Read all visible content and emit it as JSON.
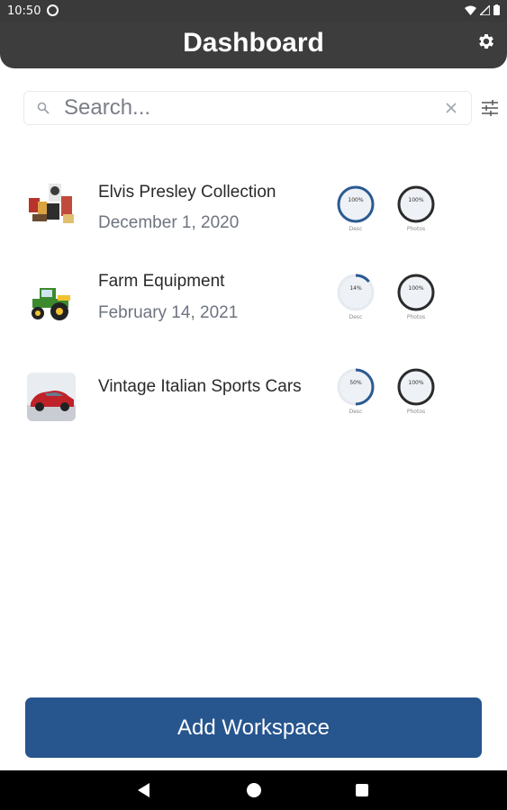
{
  "status_bar": {
    "time": "10:50"
  },
  "header": {
    "title": "Dashboard"
  },
  "search": {
    "placeholder": "Search..."
  },
  "workspaces": [
    {
      "title": "Elvis Presley Collection",
      "date": "December 1, 2020",
      "thumbnail": "memorabilia-collage",
      "desc": {
        "percent_text": "100%",
        "label": "Desc",
        "progress": 1.0
      },
      "photos": {
        "percent_text": "100%",
        "label": "Photos",
        "progress": 1.0
      }
    },
    {
      "title": "Farm Equipment",
      "date": "February 14, 2021",
      "thumbnail": "green-tractor",
      "desc": {
        "percent_text": "14%",
        "label": "Desc",
        "progress": 0.14
      },
      "photos": {
        "percent_text": "100%",
        "label": "Photos",
        "progress": 1.0
      }
    },
    {
      "title": "Vintage Italian Sports Cars",
      "date": "",
      "thumbnail": "red-sports-car",
      "desc": {
        "percent_text": "50%",
        "label": "Desc",
        "progress": 0.5
      },
      "photos": {
        "percent_text": "100%",
        "label": "Photos",
        "progress": 1.0
      }
    }
  ],
  "add_button": {
    "label": "Add Workspace"
  },
  "colors": {
    "header_bg": "#3d3d3d",
    "accent_blue": "#27558e",
    "ring_desc": "#2b5a93",
    "ring_photos": "#2b2b2b",
    "ring_track": "#e6eaf0"
  }
}
